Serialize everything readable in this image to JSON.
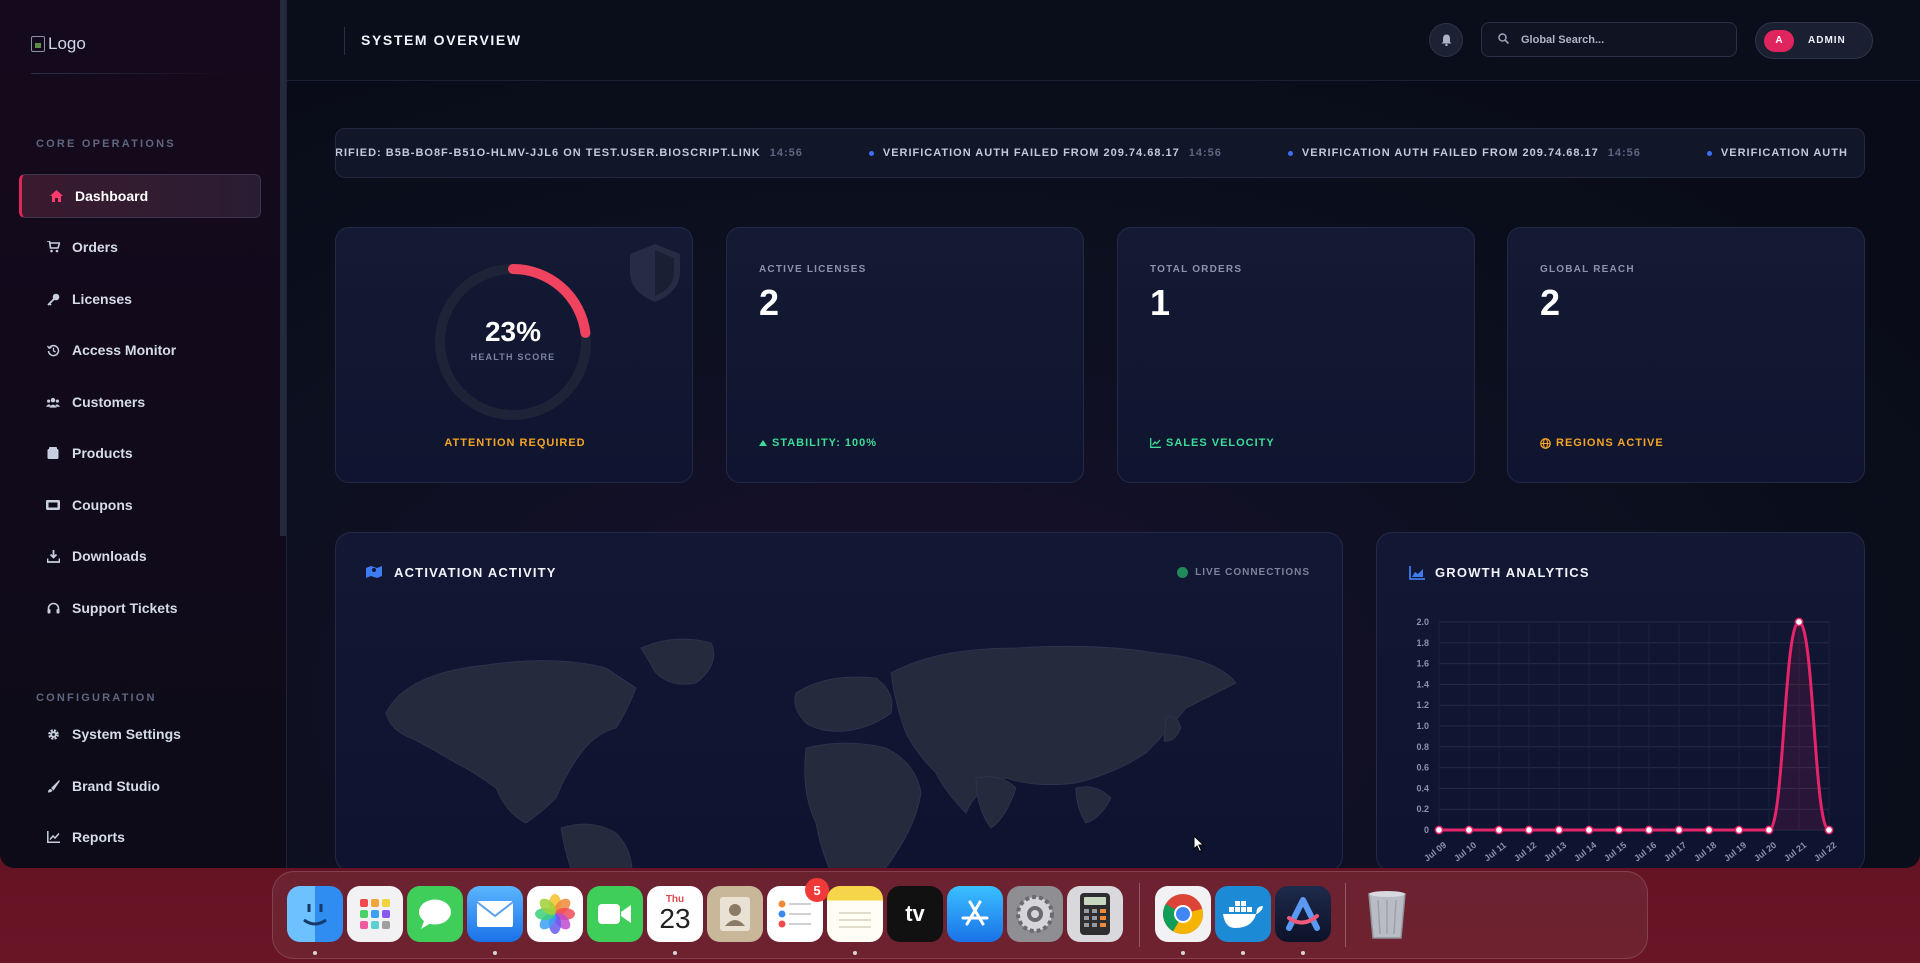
{
  "logo": {
    "alt_text": "Logo"
  },
  "sidebar": {
    "sections": [
      {
        "label": "CORE OPERATIONS"
      },
      {
        "label": "CONFIGURATION"
      }
    ],
    "core_items": [
      {
        "label": "Dashboard",
        "icon": "home-icon",
        "active": true
      },
      {
        "label": "Orders",
        "icon": "cart-icon"
      },
      {
        "label": "Licenses",
        "icon": "key-icon"
      },
      {
        "label": "Access Monitor",
        "icon": "history-icon"
      },
      {
        "label": "Customers",
        "icon": "users-icon"
      },
      {
        "label": "Products",
        "icon": "box-icon"
      },
      {
        "label": "Coupons",
        "icon": "ticket-icon"
      },
      {
        "label": "Downloads",
        "icon": "download-icon"
      },
      {
        "label": "Support Tickets",
        "icon": "headset-icon"
      }
    ],
    "config_items": [
      {
        "label": "System Settings",
        "icon": "gear-icon"
      },
      {
        "label": "Brand Studio",
        "icon": "brush-icon"
      },
      {
        "label": "Reports",
        "icon": "chart-line-icon"
      }
    ]
  },
  "header": {
    "title": "SYSTEM OVERVIEW",
    "search_placeholder": "Global Search...",
    "avatar_initial": "A",
    "user_label": "ADMIN"
  },
  "ticker": {
    "items": [
      {
        "text": "RIFIED: B5B-BO8F-B51O-HLMV-JJL6 ON TEST.USER.BIOSCRIPT.LINK",
        "time": "14:56",
        "dot": false
      },
      {
        "text": "VERIFICATION AUTH FAILED FROM 209.74.68.17",
        "time": "14:56",
        "dot": true
      },
      {
        "text": "VERIFICATION AUTH FAILED FROM 209.74.68.17",
        "time": "14:56",
        "dot": true
      },
      {
        "text": "VERIFICATION AUTH",
        "time": "",
        "dot": true
      }
    ]
  },
  "health": {
    "value": "23%",
    "fraction": 0.23,
    "label": "HEALTH SCORE",
    "status": "ATTENTION REQUIRED",
    "accent": "#f0435f"
  },
  "stats": [
    {
      "label": "ACTIVE LICENSES",
      "value": "2",
      "foot": "STABILITY: 100%",
      "foot_icon": "arrow-up-icon",
      "foot_color": "#3ddc97"
    },
    {
      "label": "TOTAL ORDERS",
      "value": "1",
      "foot": "SALES VELOCITY",
      "foot_icon": "chart-line-icon",
      "foot_color": "#3ddc97"
    },
    {
      "label": "GLOBAL REACH",
      "value": "2",
      "foot": "REGIONS ACTIVE",
      "foot_icon": "globe-icon",
      "foot_color": "#f5a524"
    }
  ],
  "activation": {
    "title": "ACTIVATION ACTIVITY",
    "live_label": "LIVE CONNECTIONS"
  },
  "growth": {
    "title": "GROWTH ANALYTICS"
  },
  "chart_data": {
    "type": "line",
    "title": "",
    "xlabel": "",
    "ylabel": "",
    "x": [
      "Jul 09",
      "Jul 10",
      "Jul 11",
      "Jul 12",
      "Jul 13",
      "Jul 14",
      "Jul 15",
      "Jul 16",
      "Jul 17",
      "Jul 18",
      "Jul 19",
      "Jul 20",
      "Jul 21",
      "Jul 22"
    ],
    "series": [
      {
        "values": [
          0,
          0,
          0,
          0,
          0,
          0,
          0,
          0,
          0,
          0,
          0,
          0,
          2,
          0
        ],
        "color": "#e6246a"
      }
    ],
    "yticks": [
      "0",
      "0.2",
      "0.4",
      "0.6",
      "0.8",
      "1.0",
      "1.2",
      "1.4",
      "1.6",
      "1.8",
      "2.0"
    ],
    "ylim": [
      0,
      2
    ],
    "grid": true,
    "legend": "none"
  },
  "dock": {
    "calendar_day": "Thu",
    "calendar_date": "23",
    "reminders_badge": "5",
    "apps": [
      "finder-icon",
      "launchpad-icon",
      "messages-icon",
      "mail-icon",
      "photos-icon",
      "facetime-icon",
      "calendar-icon",
      "contacts-icon",
      "reminders-icon",
      "notes-icon",
      "appletv-icon",
      "appstore-icon",
      "settings-icon",
      "calculator-icon",
      "chrome-icon",
      "docker-icon",
      "arc-icon",
      "trash-icon"
    ],
    "tv_label": "tv"
  }
}
